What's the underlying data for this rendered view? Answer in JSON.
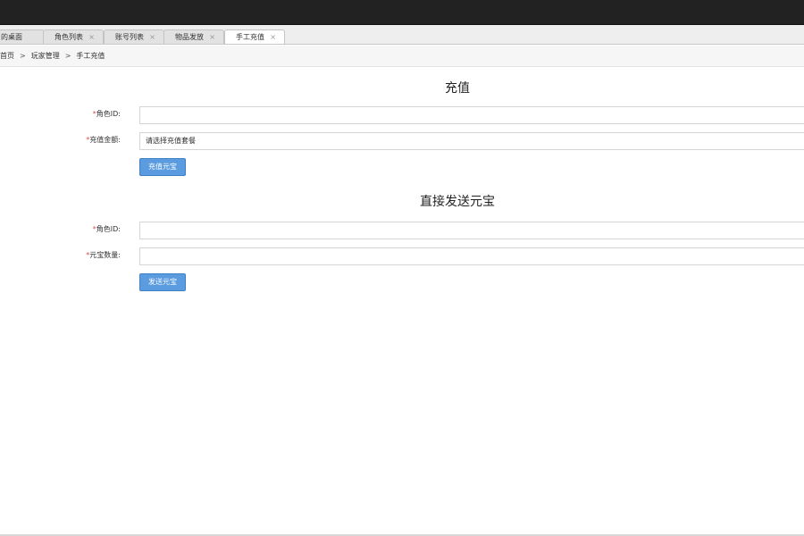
{
  "tabs": [
    {
      "label": "的桌面",
      "closable": false
    },
    {
      "label": "角色列表",
      "closable": true
    },
    {
      "label": "账号列表",
      "closable": true
    },
    {
      "label": "物品发放",
      "closable": true
    },
    {
      "label": "手工充值",
      "closable": true,
      "active": true
    }
  ],
  "tab_close_glyph": "×",
  "breadcrumb": {
    "items": [
      "首页",
      "玩家管理",
      "手工充值"
    ],
    "separator": ">"
  },
  "recharge": {
    "title": "充值",
    "required_mark": "*",
    "role_id_label": "角色ID:",
    "role_id_value": "",
    "amount_label": "充值金额:",
    "amount_selected": "请选择充值套餐",
    "submit_label": "充值元宝"
  },
  "direct_send": {
    "title": "直接发送元宝",
    "required_mark": "*",
    "role_id_label": "角色ID:",
    "role_id_value": "",
    "count_label": "元宝数量:",
    "count_value": "",
    "submit_label": "发送元宝"
  },
  "colors": {
    "topbar": "#222222",
    "accent_button": "#5b9bdf",
    "required": "#d9534f"
  }
}
